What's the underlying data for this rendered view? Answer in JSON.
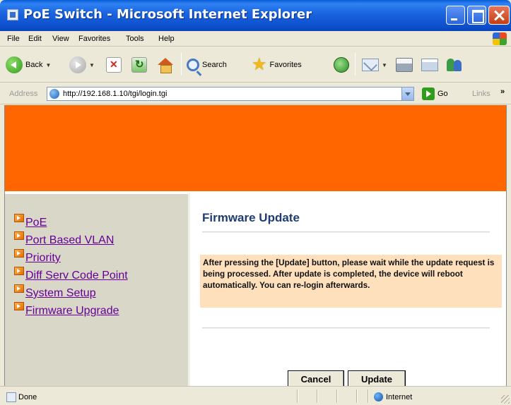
{
  "window": {
    "title": "PoE Switch - Microsoft Internet Explorer"
  },
  "menubar": {
    "items": [
      "File",
      "Edit",
      "View",
      "Favorites",
      "Tools",
      "Help"
    ]
  },
  "toolbar": {
    "back_label": "Back",
    "search_label": "Search",
    "favorites_label": "Favorites"
  },
  "addressbar": {
    "label": "Address",
    "url": "http://192.168.1.10/tgi/login.tgi",
    "go_label": "Go",
    "links_label": "Links"
  },
  "nav": {
    "items": [
      {
        "label": "PoE"
      },
      {
        "label": "Port Based VLAN"
      },
      {
        "label": "Priority"
      },
      {
        "label": "Diff Serv Code Point"
      },
      {
        "label": "System Setup"
      },
      {
        "label": "Firmware Upgrade"
      }
    ]
  },
  "main": {
    "title": "Firmware Update",
    "notice": "After pressing the [Update] button, please wait while the update request is being processed. After update is completed, the device will reboot automatically. You can re-login afterwards.",
    "cancel_label": "Cancel",
    "update_label": "Update"
  },
  "statusbar": {
    "status": "Done",
    "zone": "Internet"
  },
  "colors": {
    "banner": "#ff6600",
    "nav_bg": "#d9d7c7",
    "notice_bg": "#ffe0bc",
    "title_color": "#1f3c74",
    "link_color": "#660099"
  }
}
